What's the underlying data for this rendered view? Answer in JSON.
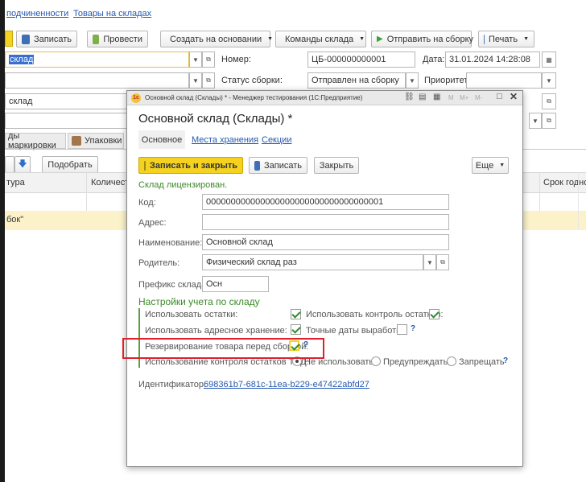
{
  "top_links": {
    "link1": "подчиненности",
    "link2": "Товары на складах"
  },
  "toolbar": {
    "save": "Записать",
    "post": "Провести",
    "create_based": "Создать на основании",
    "warehouse_commands": "Команды склада",
    "send_to_assembly": "Отправить на сборку",
    "print": "Печать"
  },
  "doc": {
    "warehouse_value": "склад",
    "number_label": "Номер:",
    "number_value": "ЦБ-000000000001",
    "date_label": "Дата:",
    "date_value": "31.01.2024 14:28:08",
    "status_label": "Статус сборки:",
    "status_value": "Отправлен на сборку",
    "priority_label": "Приоритет:",
    "priority_value": "",
    "row3_value": "склад"
  },
  "tabs": {
    "marking": "ды маркировки",
    "packages": "Упаковки"
  },
  "table": {
    "pick_button": "Подобрать",
    "col_nomenclature": "тура",
    "col_quantity": "Количест",
    "col_expiry": "Срок годнос",
    "row1_cell": "бок\""
  },
  "dialog": {
    "window_title": "Основной склад (Склады) * - Менеджер тестирования (1С:Предприятие)",
    "window_controls": {
      "m": "M",
      "mplus": "M+",
      "mminus": "M-"
    },
    "heading": "Основной склад (Склады) *",
    "tabs": [
      "Основное",
      "Места хранения",
      "Секции"
    ],
    "buttons": {
      "save_close": "Записать и закрыть",
      "save": "Записать",
      "close": "Закрыть",
      "more": "Еще"
    },
    "licensed": "Склад лицензирован.",
    "fields": {
      "code_label": "Код:",
      "code_value": "000000000000000000000000000000000001",
      "address_label": "Адрес:",
      "address_value": "",
      "name_label": "Наименование:",
      "name_value": "Основной склад",
      "parent_label": "Родитель:",
      "parent_value": "Физический склад раз",
      "prefix_label": "Префикс склада:",
      "prefix_value": "Осн"
    },
    "settings": {
      "title": "Настройки учета по складу",
      "use_remains": "Использовать остатки:",
      "use_remains_control": "Использовать контроль остатков:",
      "use_address_storage": "Использовать адресное хранение:",
      "exact_dates": "Точные даты выработки:",
      "reserve_before_assembly": "Резервирование товара перед сборкой:",
      "tsd_control": "Использование контроля остатков ТСД:",
      "opt_not_use": "Не использовать",
      "opt_warn": "Предупреждать",
      "opt_forbid": "Запрещать",
      "help_mark": "?"
    },
    "identifier_label": "Идентификатор:",
    "identifier_value": "698361b7-681c-11ea-b229-e47422abfd27"
  },
  "colors": {
    "accent_yellow": "#f4d21f",
    "highlight_red": "#e0202a",
    "row_highlight": "#fbf2c9"
  }
}
